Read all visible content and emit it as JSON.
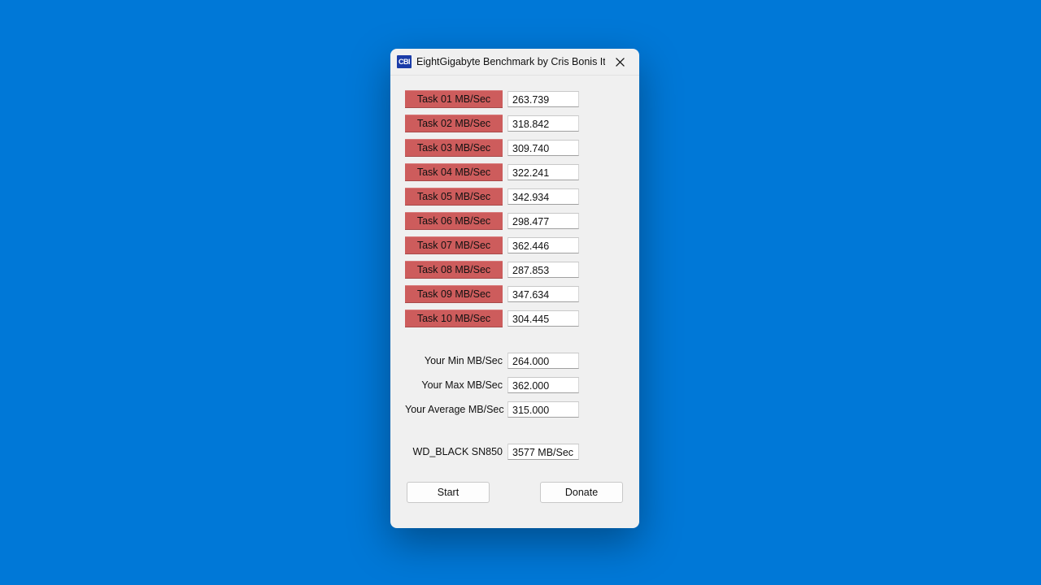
{
  "window": {
    "icon_text": "CBI",
    "title": "EightGigabyte Benchmark by Cris Bonis Italy"
  },
  "tasks": [
    {
      "label": "Task 01 MB/Sec",
      "value": "263.739"
    },
    {
      "label": "Task 02 MB/Sec",
      "value": "318.842"
    },
    {
      "label": "Task 03 MB/Sec",
      "value": "309.740"
    },
    {
      "label": "Task 04 MB/Sec",
      "value": "322.241"
    },
    {
      "label": "Task 05 MB/Sec",
      "value": "342.934"
    },
    {
      "label": "Task 06 MB/Sec",
      "value": "298.477"
    },
    {
      "label": "Task 07 MB/Sec",
      "value": "362.446"
    },
    {
      "label": "Task 08 MB/Sec",
      "value": "287.853"
    },
    {
      "label": "Task 09 MB/Sec",
      "value": "347.634"
    },
    {
      "label": "Task 10 MB/Sec",
      "value": "304.445"
    }
  ],
  "summary": [
    {
      "label": "Your Min MB/Sec",
      "value": "264.000"
    },
    {
      "label": "Your Max MB/Sec",
      "value": "362.000"
    },
    {
      "label": "Your Average MB/Sec",
      "value": "315.000"
    }
  ],
  "reference": {
    "label": "WD_BLACK SN850",
    "value": "3577 MB/Sec"
  },
  "buttons": {
    "start": "Start",
    "donate": "Donate"
  }
}
